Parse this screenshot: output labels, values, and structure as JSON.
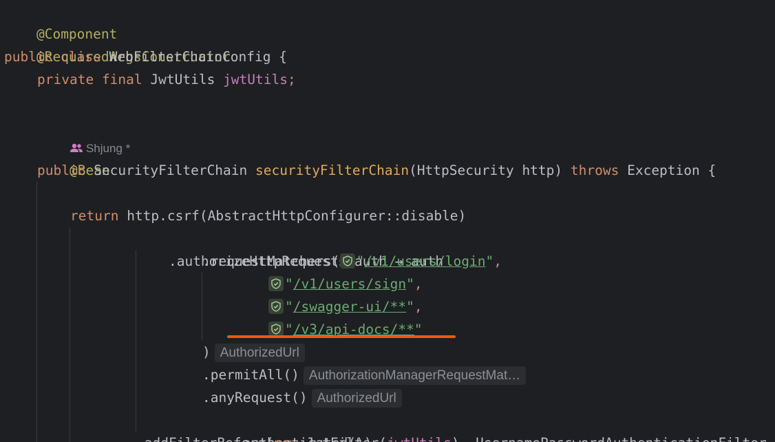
{
  "code": {
    "l1_annotation": "@Component",
    "l2_annotation": "@RequiredArgsConstructor",
    "l3_public": "public",
    "l3_class": "class",
    "l3_name": "WebFilterChainConfig",
    "l3_brace": " {",
    "l4_private": "private",
    "l4_final": "final",
    "l4_type": "JwtUtils",
    "l4_field": "jwtUtils",
    "l4_semi": ";",
    "l6_author": "Shjung *",
    "l7_annotation": "@Bean",
    "l8_public": "public",
    "l8_type": "SecurityFilterChain",
    "l8_method": "securityFilterChain",
    "l8_params": "(HttpSecurity http)",
    "l8_throws": "throws",
    "l8_exception": "Exception {",
    "l10_return": "return",
    "l10_rest": "http.csrf(AbstractHttpConfigurer::disable)",
    "l11_code": ".authorizeHttpRequests(auth → auth",
    "l12_call": ".requestMatchers(",
    "l12_q1": "\"",
    "l12_url": "/v1/users/login",
    "l12_q2": "\"",
    "l12_comma": ",",
    "l13_q1": "\"",
    "l13_url": "/v1/users/sign",
    "l13_q2": "\"",
    "l13_comma": ",",
    "l14_q1": "\"",
    "l14_url": "/swagger-ui/**",
    "l14_q2": "\"",
    "l14_comma": ",",
    "l15_q1": "\"",
    "l15_url": "/v3/api-docs/**",
    "l15_q2": "\"",
    "l16_paren": ")",
    "l16_hint": "AuthorizedUrl",
    "l17_code": ".permitAll()",
    "l17_hint": "AuthorizationManagerRequestMat…",
    "l18_code": ".anyRequest()",
    "l18_hint": "AuthorizedUrl",
    "l19_code": ".authenticated())",
    "l20_call": ".addFilterBefore(",
    "l20_new": "new",
    "l20_type": "JwtFilter(",
    "l20_field": "jwtUtils",
    "l20_rest": "), UsernamePasswordAuthenticationFilter.class)"
  },
  "icons": {
    "author": "people-icon",
    "shield": "shield-check-icon"
  },
  "colors": {
    "background": "#1e1f22",
    "keyword": "#cf8e6d",
    "annotation": "#b3ae60",
    "method": "#e0a95f",
    "field": "#c77dbb",
    "string": "#6aab73",
    "highlight_underline": "#f0580c"
  }
}
